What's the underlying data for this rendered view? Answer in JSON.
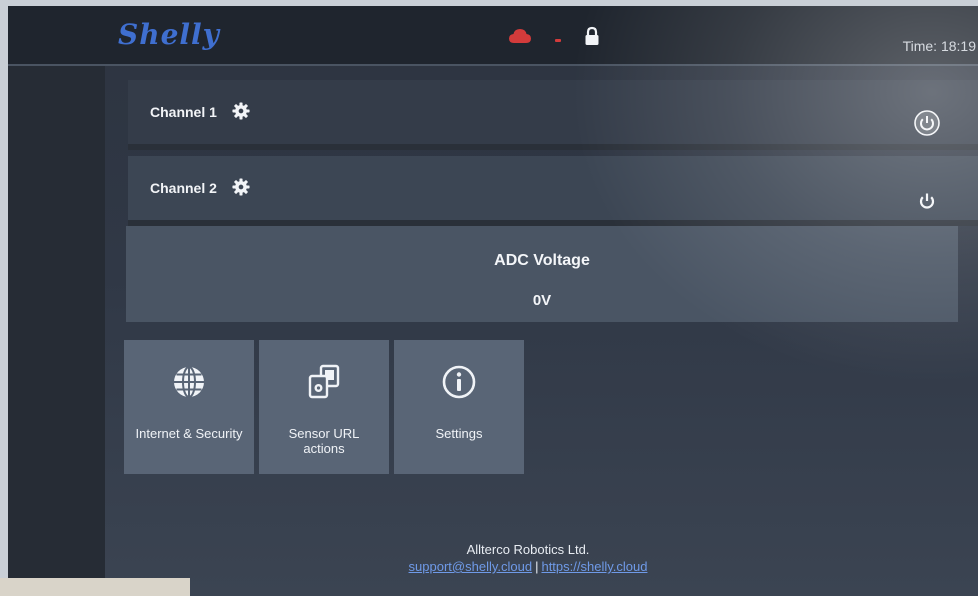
{
  "header": {
    "logo": "Shelly",
    "time_text": "Time: 18:19"
  },
  "channels": [
    {
      "label": "Channel 1"
    },
    {
      "label": "Channel 2"
    }
  ],
  "adc": {
    "title": "ADC Voltage",
    "value": "0V"
  },
  "tiles": [
    {
      "label": "Internet & Security",
      "icon": "globe-icon"
    },
    {
      "label": "Sensor URL actions",
      "icon": "sensor-actions-icon"
    },
    {
      "label": "Settings",
      "icon": "info-icon"
    }
  ],
  "footer": {
    "company": "Allterco Robotics Ltd.",
    "support_email": "support@shelly.cloud",
    "separator": "|",
    "website": "https://shelly.cloud"
  },
  "colors": {
    "logo_blue": "#3f6fd0",
    "cloud_red": "#d33b3b",
    "link_blue": "#6f9ae8"
  }
}
